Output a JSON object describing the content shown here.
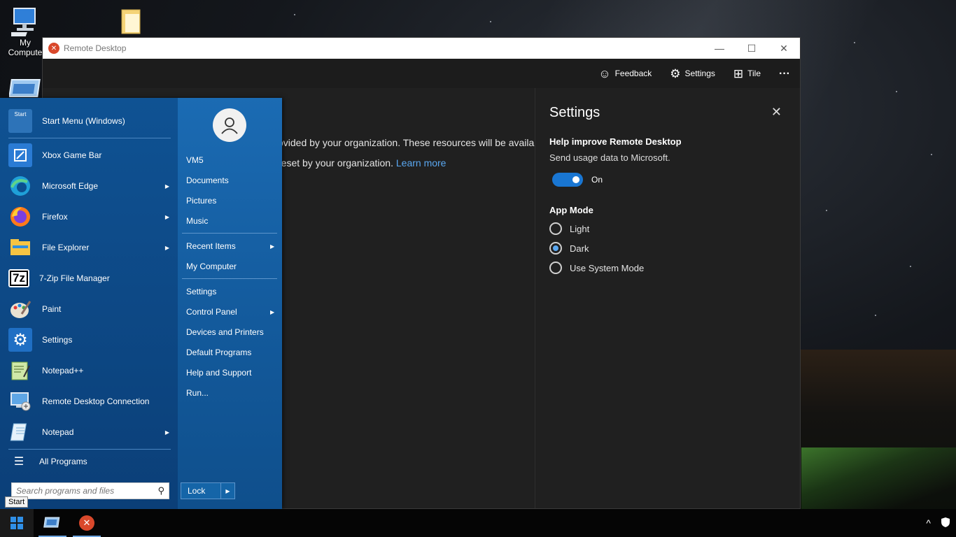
{
  "desktop": {
    "icons": [
      {
        "label": "My Compute",
        "icon": "computer-icon"
      },
      {
        "label": "",
        "icon": "folder-icon"
      },
      {
        "label": "",
        "icon": "explorer-window-icon"
      }
    ]
  },
  "rd_window": {
    "title": "Remote Desktop",
    "controls": {
      "minimize": "—",
      "maximize": "☐",
      "close": "✕"
    },
    "toolbar": {
      "feedback": "Feedback",
      "settings": "Settings",
      "tile": "Tile",
      "more": "···"
    },
    "body": {
      "line1": "ovided by your organization. These resources will be availab",
      "line2": "reset by your organization.",
      "learn_more": "Learn more"
    },
    "settings_panel": {
      "title": "Settings",
      "close": "✕",
      "telemetry_heading": "Help improve Remote Desktop",
      "telemetry_sub": "Send usage data to Microsoft.",
      "toggle_state": "On",
      "toggle_on": true,
      "app_mode_heading": "App Mode",
      "app_modes": [
        {
          "label": "Light",
          "selected": false
        },
        {
          "label": "Dark",
          "selected": true
        },
        {
          "label": "Use System Mode",
          "selected": false
        }
      ]
    }
  },
  "start_menu": {
    "programs": [
      {
        "label": "Start Menu (Windows)",
        "icon": "start-menu-icon",
        "arrow": false
      },
      {
        "label": "Xbox Game Bar",
        "icon": "xbox-icon",
        "arrow": false
      },
      {
        "label": "Microsoft Edge",
        "icon": "edge-icon",
        "arrow": true
      },
      {
        "label": "Firefox",
        "icon": "firefox-icon",
        "arrow": true
      },
      {
        "label": "File Explorer",
        "icon": "folder-icon",
        "arrow": true
      },
      {
        "label": "7-Zip File Manager",
        "icon": "7zip-icon",
        "arrow": false
      },
      {
        "label": "Paint",
        "icon": "paint-icon",
        "arrow": false
      },
      {
        "label": "Settings",
        "icon": "gear-icon",
        "arrow": false
      },
      {
        "label": "Notepad++",
        "icon": "notepadpp-icon",
        "arrow": false
      },
      {
        "label": "Remote Desktop Connection",
        "icon": "rdc-icon",
        "arrow": false
      },
      {
        "label": "Notepad",
        "icon": "notepad-icon",
        "arrow": true
      }
    ],
    "all_programs": "All Programs",
    "search_placeholder": "Search programs and files",
    "start_tooltip": "Start",
    "right_items": [
      {
        "label": "VM5",
        "arrow": false
      },
      {
        "label": "Documents",
        "arrow": false
      },
      {
        "label": "Pictures",
        "arrow": false
      },
      {
        "label": "Music",
        "arrow": false
      },
      {
        "label": "Recent Items",
        "arrow": true
      },
      {
        "label": "My Computer",
        "arrow": false
      },
      {
        "label": "Settings",
        "arrow": false
      },
      {
        "label": "Control Panel",
        "arrow": true
      },
      {
        "label": "Devices and Printers",
        "arrow": false
      },
      {
        "label": "Default Programs",
        "arrow": false
      },
      {
        "label": "Help and Support",
        "arrow": false
      },
      {
        "label": "Run...",
        "arrow": false
      }
    ],
    "lock": "Lock"
  },
  "taskbar": {
    "apps": [
      {
        "icon": "windows-start-icon"
      },
      {
        "icon": "explorer-window-icon"
      },
      {
        "icon": "remote-desktop-icon"
      }
    ],
    "tray": {
      "chevron": "^",
      "security": "shield-icon"
    }
  },
  "colors": {
    "accent": "#1976d2",
    "link": "#5aa7f0",
    "start_menu_blue": "#135a9c",
    "dark_bg": "#202020"
  }
}
